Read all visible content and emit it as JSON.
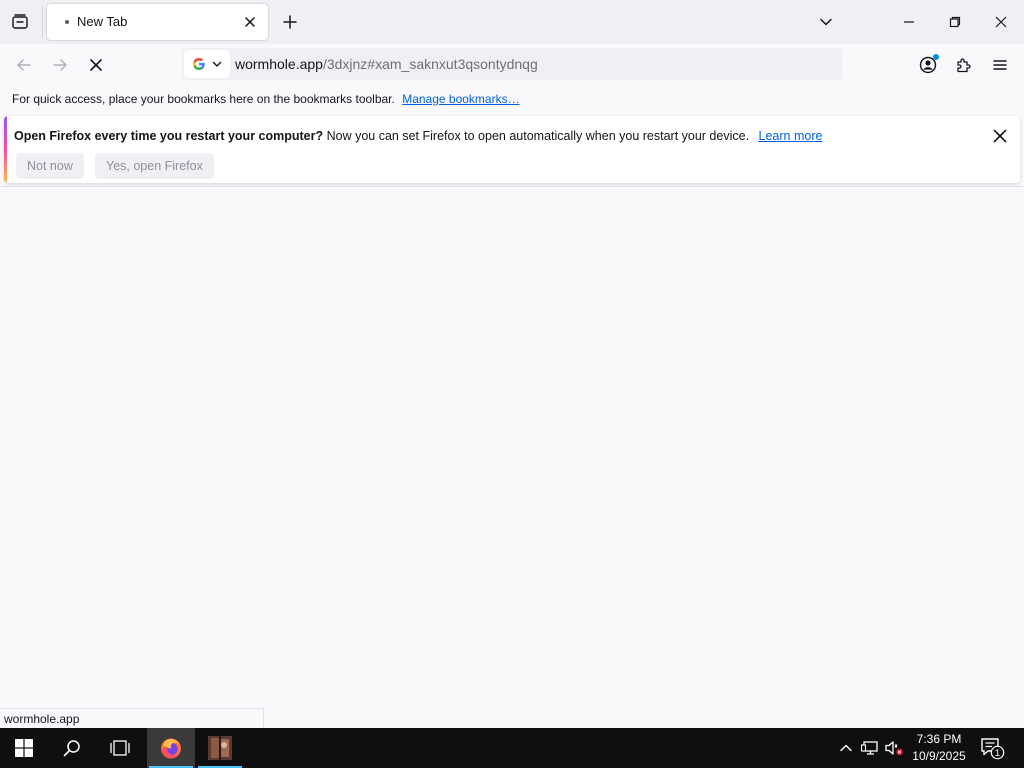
{
  "browser": {
    "tab": {
      "title": "New Tab"
    },
    "url": {
      "domain": "wormhole.app",
      "path": "/3dxjnz#xam_saknxut3qsontydnqg"
    }
  },
  "bookmarks_toolbar": {
    "text": "For quick access, place your bookmarks here on the bookmarks toolbar.",
    "link": "Manage bookmarks…"
  },
  "notification": {
    "title": "Open Firefox every time you restart your computer?",
    "body": "Now you can set Firefox to open automatically when you restart your device.",
    "link": "Learn more",
    "buttons": {
      "not_now": "Not now",
      "yes": "Yes, open Firefox"
    }
  },
  "status_bar": {
    "text": "wormhole.app"
  },
  "taskbar": {
    "time": "7:36 PM",
    "date": "10/9/2025",
    "notification_count": "1"
  },
  "colors": {
    "link": "#0061e0",
    "taskbar_bg": "#0f0f0f",
    "chrome_bg": "#f0f0f4"
  },
  "icons": [
    "tab-list-icon",
    "close-icon",
    "plus-icon",
    "chevron-down-icon",
    "minimize-icon",
    "restore-icon",
    "back-icon",
    "forward-icon",
    "stop-icon",
    "google-icon",
    "account-icon",
    "extensions-icon",
    "menu-icon",
    "windows-start-icon",
    "search-icon",
    "task-view-icon",
    "firefox-icon",
    "chevron-up-icon",
    "network-icon",
    "volume-muted-icon",
    "notification-icon"
  ]
}
